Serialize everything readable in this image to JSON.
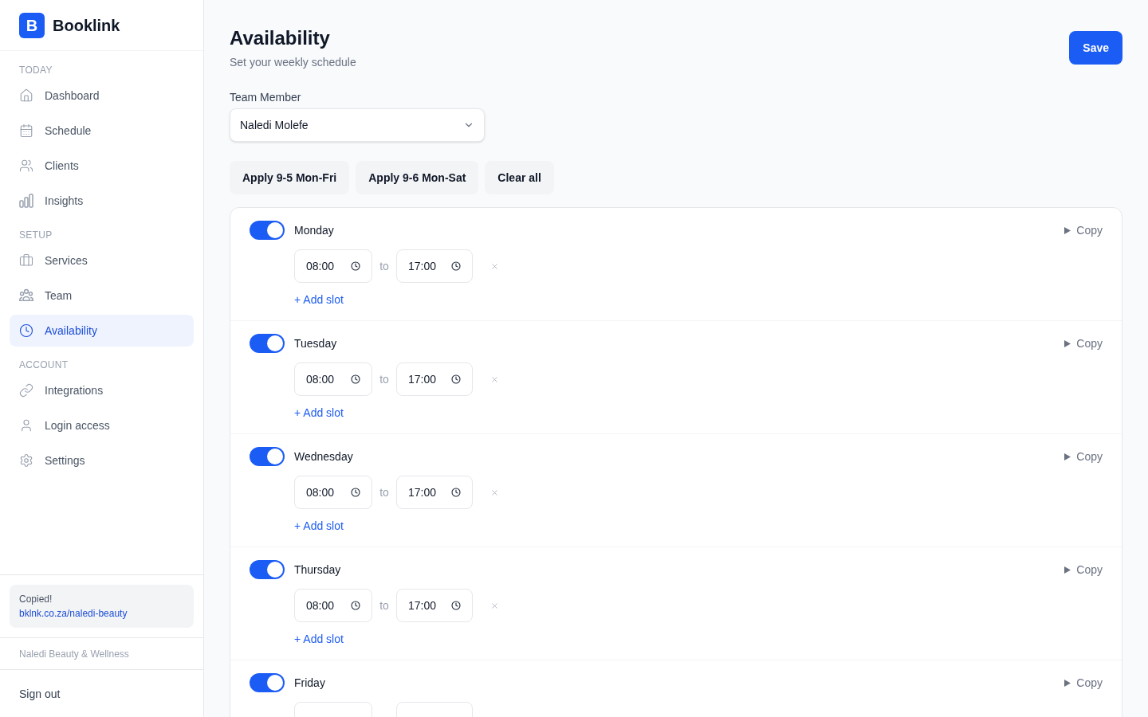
{
  "brand": {
    "logo_letter": "B",
    "name": "Booklink"
  },
  "sidebar": {
    "sections": [
      {
        "title": "TODAY",
        "items": [
          {
            "label": "Dashboard",
            "selected": false
          },
          {
            "label": "Schedule",
            "selected": false
          },
          {
            "label": "Clients",
            "selected": false
          },
          {
            "label": "Insights",
            "selected": false
          }
        ]
      },
      {
        "title": "SETUP",
        "items": [
          {
            "label": "Services",
            "selected": false
          },
          {
            "label": "Team",
            "selected": false
          },
          {
            "label": "Availability",
            "selected": true
          }
        ]
      },
      {
        "title": "ACCOUNT",
        "items": [
          {
            "label": "Integrations",
            "selected": false
          },
          {
            "label": "Login access",
            "selected": false
          },
          {
            "label": "Settings",
            "selected": false
          }
        ]
      }
    ],
    "copied_notice": {
      "title": "Copied!",
      "link": "bklnk.co.za/naledi-beauty"
    },
    "business_name": "Naledi Beauty & Wellness",
    "sign_out": "Sign out"
  },
  "header": {
    "title": "Availability",
    "subtitle": "Set your weekly schedule",
    "save_button": "Save"
  },
  "team_member": {
    "label": "Team Member",
    "value": "Naledi Molefe"
  },
  "presets": [
    "Apply 9-5 Mon-Fri",
    "Apply 9-6 Mon-Sat",
    "Clear all"
  ],
  "days": [
    {
      "name": "Monday",
      "on": true,
      "copy": "Copy",
      "slots": [
        {
          "kind": "range",
          "start": "08:00",
          "separator": "to",
          "end": "17:00"
        }
      ],
      "add_slot": "+ Add slot"
    },
    {
      "name": "Tuesday",
      "on": true,
      "copy": "Copy",
      "slots": [
        {
          "kind": "range",
          "start": "08:00",
          "separator": "to",
          "end": "17:00"
        }
      ],
      "add_slot": "+ Add slot"
    },
    {
      "name": "Wednesday",
      "on": true,
      "copy": "Copy",
      "slots": [
        {
          "kind": "range",
          "start": "08:00",
          "separator": "to",
          "end": "17:00"
        }
      ],
      "add_slot": "+ Add slot"
    },
    {
      "name": "Thursday",
      "on": true,
      "copy": "Copy",
      "slots": [
        {
          "kind": "range",
          "start": "08:00",
          "separator": "to",
          "end": "17:00"
        }
      ],
      "add_slot": "+ Add slot"
    },
    {
      "name": "Friday",
      "on": true,
      "copy": "Copy",
      "slots": [
        {
          "kind": "range"
        }
      ]
    }
  ]
}
